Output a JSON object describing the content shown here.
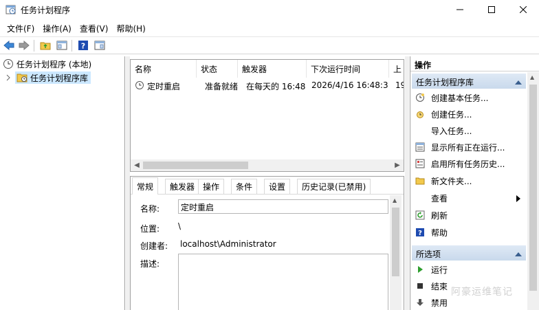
{
  "window": {
    "title": "任务计划程序"
  },
  "menu": [
    "文件(F)",
    "操作(A)",
    "查看(V)",
    "帮助(H)"
  ],
  "tree": {
    "root": "任务计划程序 (本地)",
    "library": "任务计划程序库"
  },
  "list": {
    "headers": [
      "名称",
      "状态",
      "触发器",
      "下次运行时间",
      "上"
    ],
    "rows": [
      {
        "name": "定时重启",
        "status": "准备就绪",
        "trigger": "在每天的 16:48",
        "next": "2026/4/16 16:48:36",
        "last": "19"
      }
    ]
  },
  "detail": {
    "tabs": [
      "常规",
      "触发器",
      "操作",
      "条件",
      "设置",
      "历史记录(已禁用)"
    ],
    "name_label": "名称:",
    "name_value": "定时重启",
    "location_label": "位置:",
    "location_value": "\\",
    "author_label": "创建者:",
    "author_value": "localhost\\Administrator",
    "desc_label": "描述:"
  },
  "actions": {
    "header": "操作",
    "section1": "任务计划程序库",
    "items1": [
      "创建基本任务...",
      "创建任务...",
      "导入任务...",
      "显示所有正在运行...",
      "启用所有任务历史...",
      "新文件夹...",
      "查看",
      "刷新",
      "帮助"
    ],
    "section2": "所选项",
    "items2": [
      "运行",
      "结束",
      "禁用"
    ]
  },
  "watermark": "阿豪运维笔记",
  "colors": {
    "selection": "#cce8ff",
    "section_bg": "#d4e2f1",
    "help_blue": "#1e4bb0",
    "run_green": "#2e9e2e"
  }
}
